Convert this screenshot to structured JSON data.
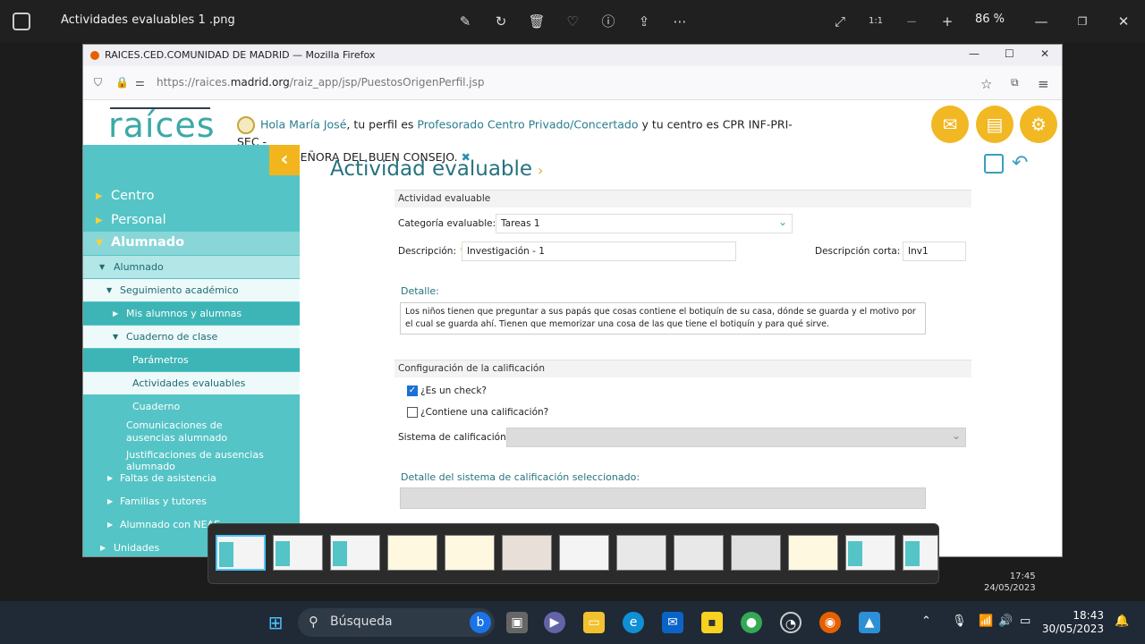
{
  "viewer": {
    "title": "Actividades evaluables 1 .png",
    "zoom": "86 %",
    "ratio_label": "1:1"
  },
  "browser": {
    "window_title": "RAICES.CED.COMUNIDAD DE MADRID — Mozilla Firefox",
    "url_prefix": "https://raices.",
    "url_domain": "madrid.org",
    "url_path": "/raiz_app/jsp/PuestosOrigenPerfil.jsp"
  },
  "header": {
    "logo": "raíces",
    "greeting": "Hola María José",
    "profile_prefix": ", tu perfil es ",
    "profile": "Profesorado Centro Privado/Concertado",
    "center_prefix": " y tu centro es CPR INF-PRI-SEC -",
    "center_line2": "NUESTRA SEÑORA DEL BUEN CONSEJO.",
    "close_glyph": "✖"
  },
  "sidebar": {
    "items": [
      {
        "label": "Centro"
      },
      {
        "label": "Personal"
      },
      {
        "label": "Alumnado"
      },
      {
        "label": "Alumnado"
      },
      {
        "label": "Seguimiento académico"
      },
      {
        "label": "Mis alumnos y alumnas"
      },
      {
        "label": "Cuaderno de clase"
      },
      {
        "label": "Parámetros"
      },
      {
        "label": "Actividades evaluables"
      },
      {
        "label": "Cuaderno"
      },
      {
        "label": "Comunicaciones de ausencias alumnado"
      },
      {
        "label": "Justificaciones de ausencias alumnado"
      },
      {
        "label": "Faltas de asistencia"
      },
      {
        "label": "Familias y tutores"
      },
      {
        "label": "Alumnado con NEAE"
      },
      {
        "label": "Unidades"
      }
    ]
  },
  "main": {
    "title": "Actividad evaluable",
    "section1": "Actividad evaluable",
    "categoria_label": "Categoría evaluable:",
    "categoria_value": "Tareas 1",
    "descripcion_label": "Descripción:",
    "descripcion_value": "Investigación - 1",
    "desc_corta_label": "Descripción corta:",
    "desc_corta_value": "Inv1",
    "detalle_label": "Detalle:",
    "detalle_value": "Los niños tienen que preguntar a sus papás que cosas contiene el botiquín de su casa, dónde se guarda y el motivo por el cual se guarda ahí. Tienen que memorizar una cosa de las que tiene el botiquín y para qué sirve.",
    "section2": "Configuración de la calificación",
    "check1_label": "¿Es un check?",
    "check2_label": "¿Contiene una calificación?",
    "sistema_label": "Sistema de calificación:",
    "detalle_sistema_label": "Detalle del sistema de calificación seleccionado:"
  },
  "inner_clock": {
    "time": "17:45",
    "date": "24/05/2023"
  },
  "taskbar": {
    "search_placeholder": "Búsqueda",
    "time": "18:43",
    "date": "30/05/2023"
  }
}
